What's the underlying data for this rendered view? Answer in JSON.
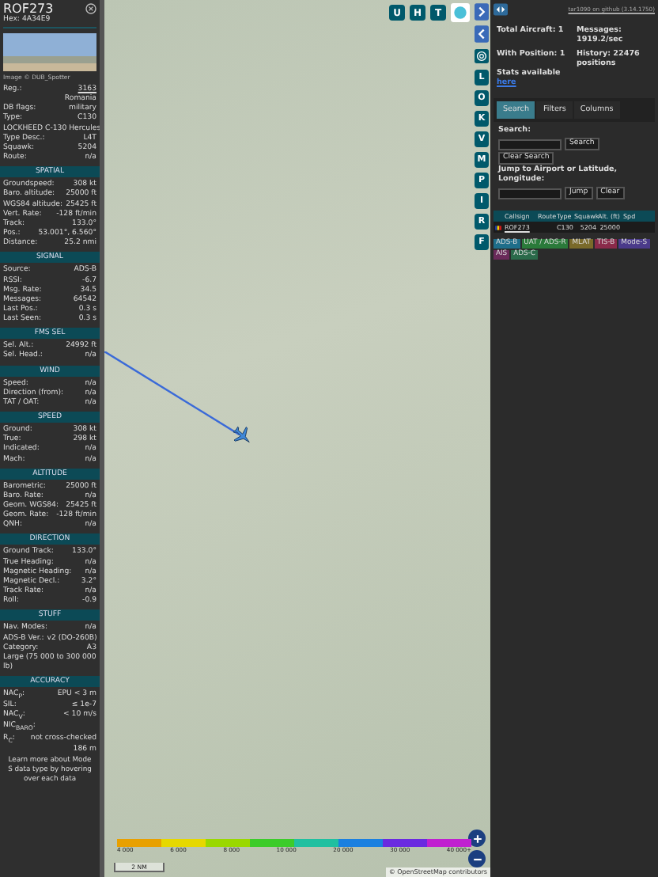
{
  "aircraft": {
    "callsign": "ROF273",
    "hex_label": "Hex:",
    "hex": "4A34E9",
    "image_credit": "Image © DUB_Spotter"
  },
  "info_rows": [
    {
      "label": "Reg.:",
      "value": "3163",
      "kind": "link"
    },
    {
      "label": "",
      "value": "Romania",
      "kind": "text"
    },
    {
      "label": "DB flags:",
      "value": "military",
      "kind": "text"
    },
    {
      "label": "Type:",
      "value": "C130",
      "kind": "text"
    },
    {
      "label": "",
      "value": "LOCKHEED C-130 Hercules",
      "kind": "text"
    },
    {
      "label": "Type Desc.:",
      "value": "L4T",
      "kind": "text"
    },
    {
      "label": "Squawk:",
      "value": "5204",
      "kind": "text"
    },
    {
      "label": "Route:",
      "value": "n/a",
      "kind": "text"
    }
  ],
  "sections": [
    {
      "title": "SPATIAL",
      "rows": [
        {
          "label": "Groundspeed:",
          "value": "308 kt"
        },
        {
          "label": "Baro. altitude:",
          "value": "25000 ft"
        },
        {
          "label": "WGS84 altitude:",
          "value": "25425 ft"
        },
        {
          "label": "Vert. Rate:",
          "value": "-128 ft/min"
        },
        {
          "label": "Track:",
          "value": "133.0°"
        },
        {
          "label": "Pos.:",
          "value": "53.001°, 6.560°"
        },
        {
          "label": "Distance:",
          "value": "25.2 nmi"
        }
      ]
    },
    {
      "title": "SIGNAL",
      "rows": [
        {
          "label": "Source:",
          "value": "ADS-B"
        },
        {
          "label": "RSSI:",
          "value": "-6.7"
        },
        {
          "label": "Msg. Rate:",
          "value": "34.5"
        },
        {
          "label": "Messages:",
          "value": "64542"
        },
        {
          "label": "Last Pos.:",
          "value": "0.3 s"
        },
        {
          "label": "Last Seen:",
          "value": "0.3 s"
        }
      ]
    },
    {
      "title": "FMS SEL",
      "rows": [
        {
          "label": "Sel. Alt.:",
          "value": "24992 ft"
        },
        {
          "label": "Sel. Head.:",
          "value": "n/a"
        }
      ]
    },
    {
      "title": "WIND",
      "rows": [
        {
          "label": "Speed:",
          "value": "n/a"
        },
        {
          "label": "Direction (from):",
          "value": "n/a"
        },
        {
          "label": "TAT / OAT:",
          "value": "n/a"
        }
      ]
    },
    {
      "title": "SPEED",
      "rows": [
        {
          "label": "Ground:",
          "value": "308 kt"
        },
        {
          "label": "True:",
          "value": "298 kt"
        },
        {
          "label": "Indicated:",
          "value": "n/a"
        },
        {
          "label": "Mach:",
          "value": "n/a"
        }
      ]
    },
    {
      "title": "ALTITUDE",
      "rows": [
        {
          "label": "Barometric:",
          "value": "25000 ft"
        },
        {
          "label": "Baro. Rate:",
          "value": "n/a"
        },
        {
          "label": "Geom. WGS84:",
          "value": "25425 ft"
        },
        {
          "label": "Geom. Rate:",
          "value": "-128 ft/min"
        },
        {
          "label": "QNH:",
          "value": "n/a"
        }
      ]
    },
    {
      "title": "DIRECTION",
      "rows": [
        {
          "label": "Ground Track:",
          "value": "133.0°"
        },
        {
          "label": "True Heading:",
          "value": "n/a"
        },
        {
          "label": "Magnetic Heading:",
          "value": "n/a"
        },
        {
          "label": "Magnetic Decl.:",
          "value": "3.2°"
        },
        {
          "label": "Track Rate:",
          "value": "n/a"
        },
        {
          "label": "Roll:",
          "value": "-0.9"
        }
      ]
    },
    {
      "title": "STUFF",
      "rows": [
        {
          "label": "Nav. Modes:",
          "value": "n/a"
        },
        {
          "label": "ADS-B Ver.:",
          "value": "v2 (DO-260B)"
        },
        {
          "label": "Category:",
          "value": "A3"
        },
        {
          "label": "Large (75 000 to 300 000 lb)",
          "value": ""
        }
      ]
    },
    {
      "title": "ACCURACY",
      "rows": [
        {
          "label": "NAC$_{P}$:",
          "value": "EPU < 3 m"
        },
        {
          "label": "SIL:",
          "value": "≤ 1e-7"
        },
        {
          "label": "NAC$_{V}$:",
          "value": "< 10 m/s"
        },
        {
          "label": "NIC$_{BARO}$:",
          "value": ""
        },
        {
          "label": "R$_{C}$:",
          "value": "not cross-checked"
        },
        {
          "label": "",
          "value": "186 m"
        }
      ]
    }
  ],
  "note": "Learn more about Mode S data type by hovering over each data",
  "map_buttons_top": [
    "U",
    "H",
    "T"
  ],
  "map_buttons_side": [
    "L",
    "O",
    "K",
    "V",
    "M",
    "P",
    "I",
    "R",
    "F"
  ],
  "altitude_legend": [
    "4 000",
    "6 000",
    "8 000",
    "10 000",
    "20 000",
    "30 000",
    "40 000+"
  ],
  "scale": "2 NM",
  "attribution": "© OpenStreetMap contributors",
  "sidebar": {
    "version_link": "tar1090 on github (3.14.1750)",
    "stats": [
      {
        "label": "Total Aircraft: 1"
      },
      {
        "label": "Messages: 1919.2/sec"
      },
      {
        "label": "With Position: 1"
      },
      {
        "label": "History: 22476 positions"
      }
    ],
    "stats_text": "Stats available",
    "stats_link": "here",
    "tabs": [
      {
        "label": "Search",
        "selected": true
      },
      {
        "label": "Filters",
        "selected": false
      },
      {
        "label": "Columns",
        "selected": false
      }
    ],
    "search_label": "Search:",
    "search_button": "Search",
    "clear_search_button": "Clear Search",
    "jump_label": "Jump to Airport or Latitude, Longitude:",
    "jump_button": "Jump",
    "clear_button": "Clear",
    "columns": [
      "Callsign",
      "Route",
      "Type",
      "Squawk",
      "Alt. (ft)",
      "Spd"
    ],
    "rows": [
      {
        "callsign": "ROF273",
        "route": "",
        "type": "C130",
        "squawk": "5204",
        "altitude": "25000",
        "speed": ""
      }
    ],
    "sources": [
      {
        "label": "ADS-B",
        "color": "#1e6e8a"
      },
      {
        "label": "UAT / ADS-R",
        "color": "#2a7a3a"
      },
      {
        "label": "MLAT",
        "color": "#7a6a2a"
      },
      {
        "label": "TIS-B",
        "color": "#8a2a4a"
      },
      {
        "label": "Mode-S",
        "color": "#4a3a8a"
      },
      {
        "label": "AIS",
        "color": "#6a2a5a"
      },
      {
        "label": "ADS-C",
        "color": "#2a6a4a"
      }
    ]
  }
}
